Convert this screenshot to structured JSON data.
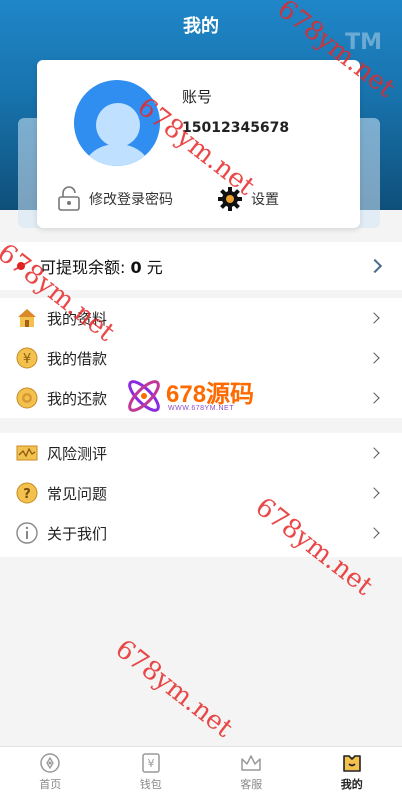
{
  "header": {
    "title": "我的",
    "tm_mark": "TM"
  },
  "profile": {
    "account_label": "账号",
    "phone": "15012345678",
    "change_password_label": "修改登录密码",
    "settings_label": "设置"
  },
  "balance": {
    "prefix": "可提现余额: ",
    "amount": "0",
    "unit": " 元"
  },
  "menu_group_1": [
    {
      "label": "我的资料",
      "icon": "house-icon"
    },
    {
      "label": "我的借款",
      "icon": "yuan-coin-icon"
    },
    {
      "label": "我的还款",
      "icon": "coin-icon"
    }
  ],
  "menu_group_2": [
    {
      "label": "风险测评",
      "icon": "risk-chart-icon"
    },
    {
      "label": "常见问题",
      "icon": "question-icon"
    },
    {
      "label": "关于我们",
      "icon": "info-icon"
    }
  ],
  "tabbar": [
    {
      "label": "首页",
      "icon": "home-compass-icon"
    },
    {
      "label": "钱包",
      "icon": "wallet-icon"
    },
    {
      "label": "客服",
      "icon": "crown-service-icon"
    },
    {
      "label": "我的",
      "icon": "profile-icon",
      "active": true
    }
  ],
  "watermarks": {
    "site": "678ym.net",
    "logo_text": "678源码",
    "logo_sub": "WWW.678YM.NET"
  },
  "colors": {
    "header_top": "#1f86c8",
    "header_bottom": "#0f4f7a",
    "avatar": "#2f8ef0",
    "balance_dot": "#e02020",
    "watermark": "#e62828"
  }
}
